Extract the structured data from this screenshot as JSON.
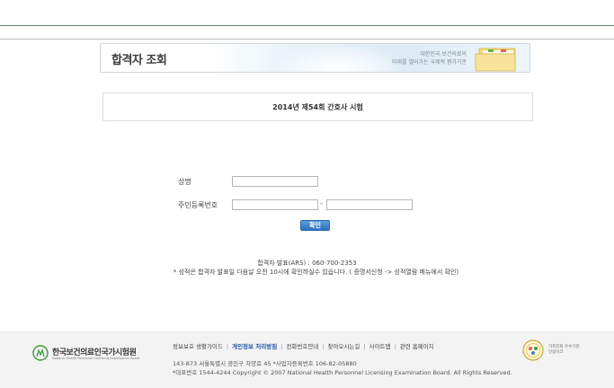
{
  "banner": {
    "title": "합격자 조회",
    "slogan_line1": "대한민국 보건의료의",
    "slogan_line2": "미래를 열어가는 국제적 평가기관"
  },
  "exam": {
    "title": "2014년 제54회 간호사 시험"
  },
  "form": {
    "name_label": "성명",
    "name_value": "",
    "rrn_label": "주민등록번호",
    "rrn_first_value": "",
    "rrn_second_value": "",
    "rrn_separator": "-",
    "confirm_label": "확인"
  },
  "info": {
    "ars": "합격자 발표(ARS) : 060-700-2353",
    "notice": "* 성적은 합격자 발표일 다음날 오전 10시에 확인하실수 있습니다. ( 증명서신청 -> 성적열람 메뉴에서 확인)"
  },
  "footer": {
    "org_name": "한국보건의료인국가시험원",
    "org_name_en": "National Health Personnel Licensing Examination Board",
    "links": [
      "정보보호 생활가이드",
      "개인정보 처리방침",
      "전화번호안내",
      "찾아오시는길",
      "사이트맵",
      "관련 홈페이지"
    ],
    "address": "143-873 서울특별시 광진구 자양로 45  *사업자등록번호 106-82-05880",
    "copyright": "*대표번호 1544-4244  Copyright © 2007 National Health Personnel Licensing Examination Board. All Rights Reserved.",
    "cert_line1": "가족친화 우수기관",
    "cert_line2": "인증마크"
  },
  "colors": {
    "confirm_button": "#3b82c9",
    "highlight_link": "#1f56a8",
    "top_line": "#5a8a5a"
  }
}
